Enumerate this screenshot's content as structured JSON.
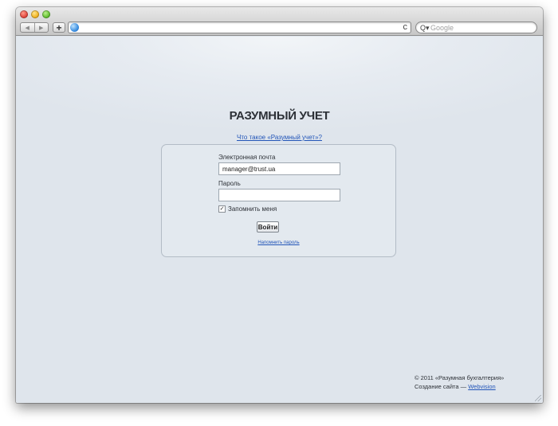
{
  "browser": {
    "back_glyph": "◀",
    "forward_glyph": "▶",
    "add_glyph": "+",
    "reload_glyph": "c",
    "search_icon_glyph": "Q▾",
    "search_placeholder": "Google"
  },
  "page": {
    "site_title": "РАЗУМНЫЙ УЧЕТ",
    "about_link": "Что такое «Разумный учет»?",
    "login": {
      "email_label": "Электронная почта",
      "email_value": "manager@trust.ua",
      "password_label": "Пароль",
      "password_value": "",
      "remember_checked": true,
      "remember_label": "Запомнить меня",
      "submit_label": "Войти",
      "remind_link": "Напомнить пароль"
    },
    "footer": {
      "copyright": "© 2011 «Разумная бухгалтерия»",
      "created_by_prefix": "Создание сайта — ",
      "created_by_link": "Webvision"
    }
  },
  "colors": {
    "link": "#2255b8",
    "text": "#2d3137",
    "background": "#dfe5ec"
  }
}
